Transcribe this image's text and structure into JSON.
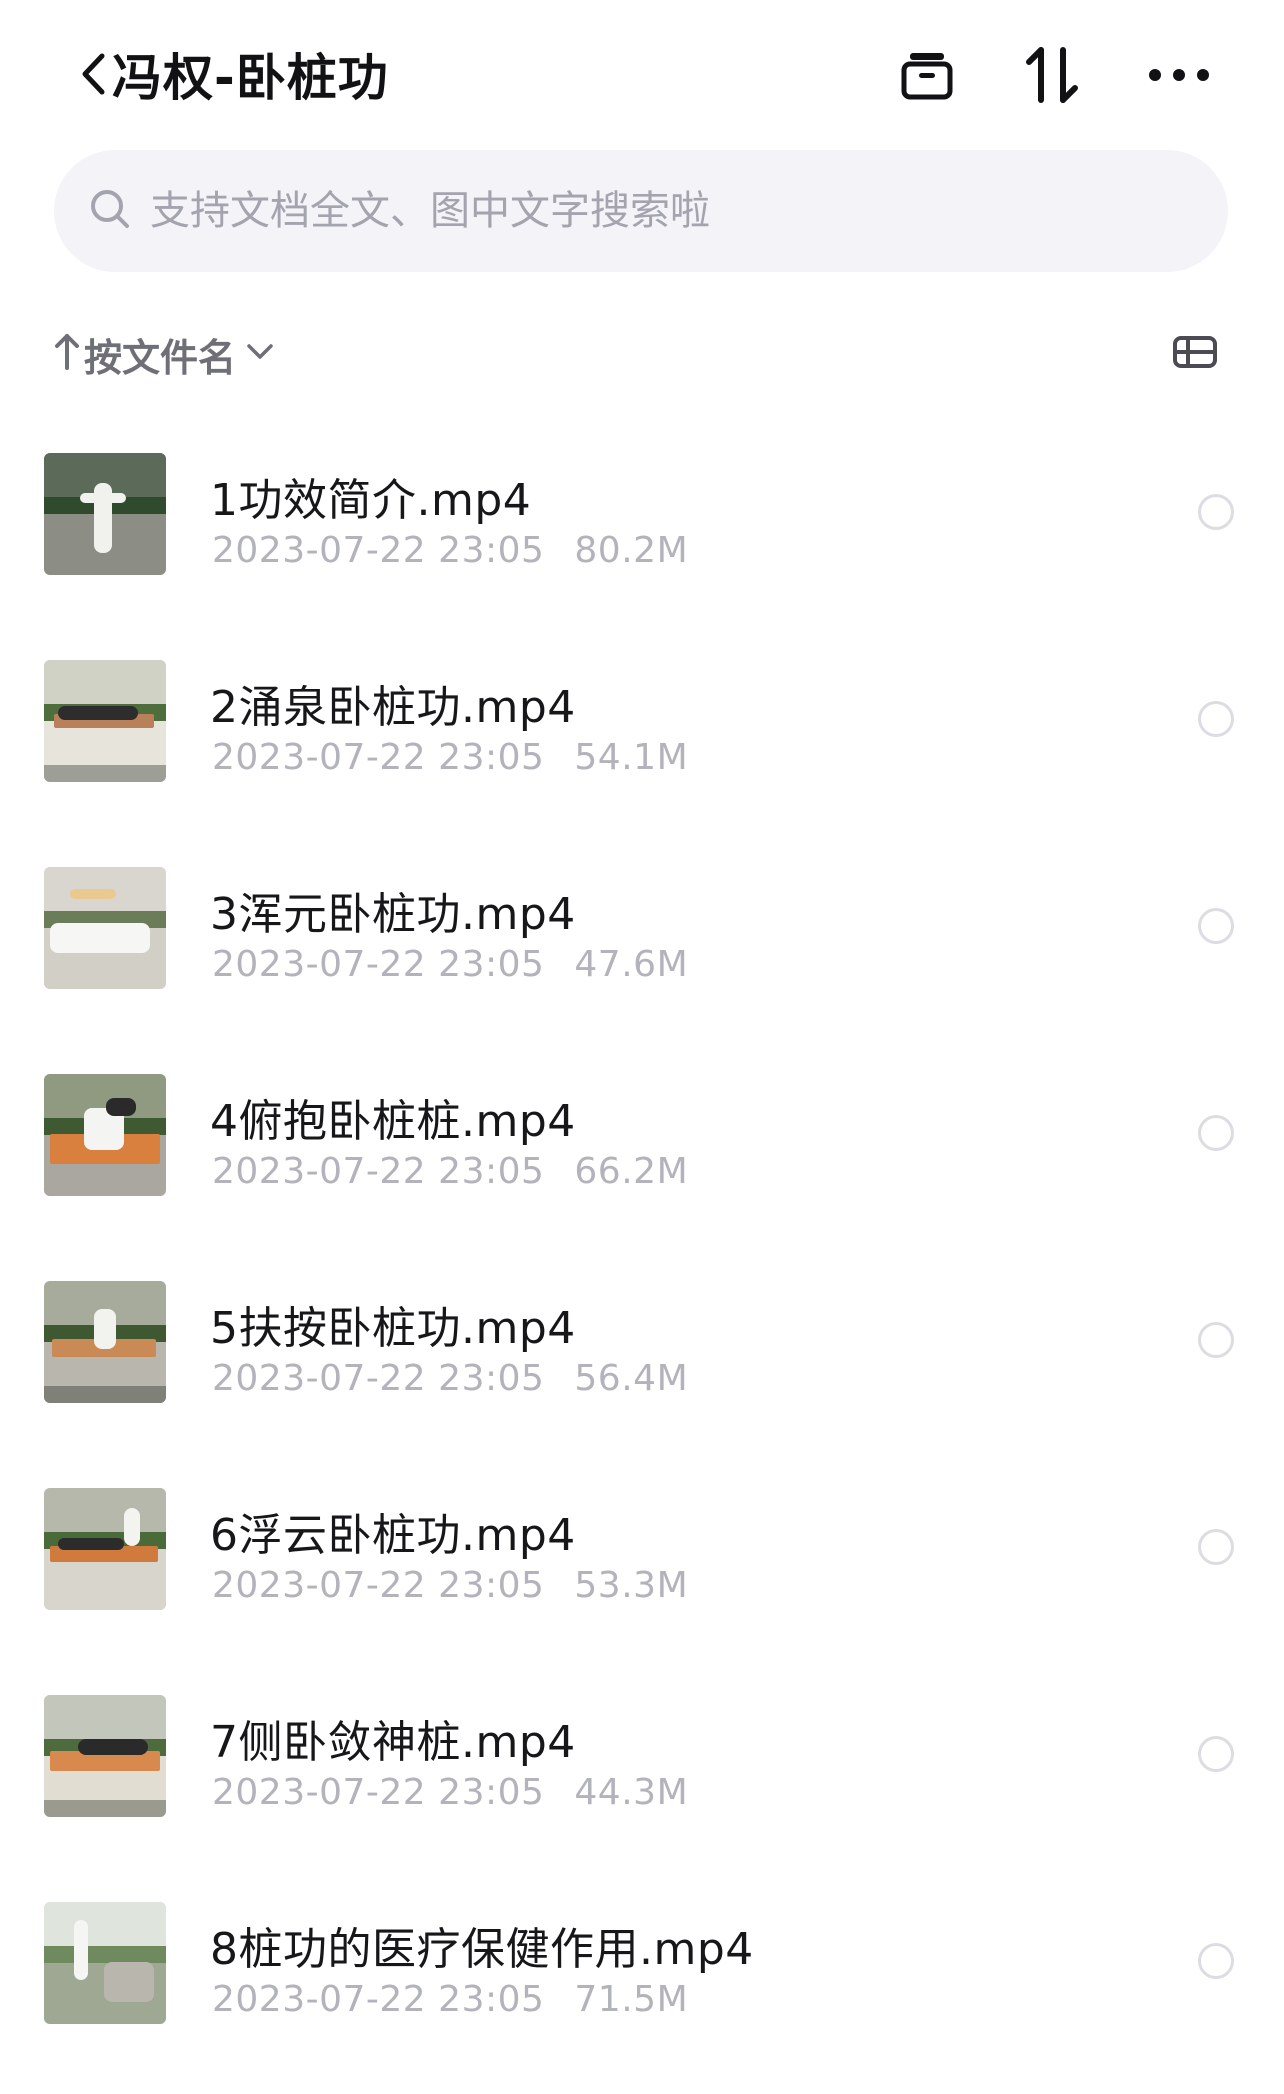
{
  "header": {
    "title": "冯权-卧桩功",
    "icons": {
      "back": "chevron-left-icon",
      "archive": "archive-box-icon",
      "sort": "sort-arrows-icon",
      "more": "more-dots-icon"
    }
  },
  "search": {
    "placeholder": "支持文档全文、图中文字搜索啦",
    "value": ""
  },
  "sort": {
    "label": "按文件名",
    "direction": "ascending"
  },
  "files": [
    {
      "name": "1功效简介.mp4",
      "date": "2023-07-22 23:05",
      "size": "80.2M"
    },
    {
      "name": "2涌泉卧桩功.mp4",
      "date": "2023-07-22 23:05",
      "size": "54.1M"
    },
    {
      "name": "3浑元卧桩功.mp4",
      "date": "2023-07-22 23:05",
      "size": "47.6M"
    },
    {
      "name": "4俯抱卧桩桩.mp4",
      "date": "2023-07-22 23:05",
      "size": "66.2M"
    },
    {
      "name": "5扶按卧桩功.mp4",
      "date": "2023-07-22 23:05",
      "size": "56.4M"
    },
    {
      "name": "6浮云卧桩功.mp4",
      "date": "2023-07-22 23:05",
      "size": "53.3M"
    },
    {
      "name": "7侧卧敛神桩.mp4",
      "date": "2023-07-22 23:05",
      "size": "44.3M"
    },
    {
      "name": "8桩功的医疗保健作用.mp4",
      "date": "2023-07-22 23:05",
      "size": "71.5M"
    }
  ],
  "colors": {
    "title": "#121214",
    "meta": "#b2b3bb",
    "search_bg": "#f3f3f8",
    "placeholder": "#a3a4ad"
  }
}
